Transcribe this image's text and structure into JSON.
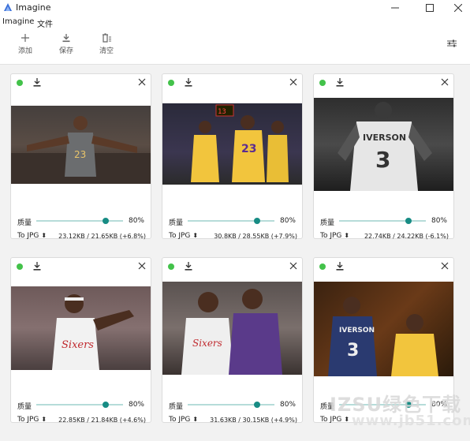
{
  "app": {
    "title": "Imagine",
    "accent": "#178c84",
    "status_color": "#43c24a"
  },
  "menu": [
    "Imagine",
    "文件"
  ],
  "toolbar": {
    "add_label": "添加",
    "save_label": "保存",
    "clear_label": "清空"
  },
  "cards": [
    {
      "quality_label": "质量",
      "quality": 0.8,
      "quality_text": "80%",
      "format": "To JPG",
      "size_text": "23.12KB / 21.65KB (+6.8%)"
    },
    {
      "quality_label": "质量",
      "quality": 0.8,
      "quality_text": "80%",
      "format": "To JPG",
      "size_text": "30.8KB / 28.55KB (+7.9%)"
    },
    {
      "quality_label": "质量",
      "quality": 0.8,
      "quality_text": "80%",
      "format": "To JPG",
      "size_text": "22.74KB / 24.22KB (-6.1%)"
    },
    {
      "quality_label": "质量",
      "quality": 0.8,
      "quality_text": "80%",
      "format": "To JPG",
      "size_text": "22.85KB / 21.84KB (+4.6%)"
    },
    {
      "quality_label": "质量",
      "quality": 0.8,
      "quality_text": "80%",
      "format": "To JPG",
      "size_text": "31.63KB / 30.15KB (+4.9%)"
    },
    {
      "quality_label": "质量",
      "quality": 0.8,
      "quality_text": "80%",
      "format": "To JPG",
      "size_text": ""
    }
  ],
  "watermark": {
    "text": "IZSU绿色下载",
    "url": "www.jb51.com"
  }
}
